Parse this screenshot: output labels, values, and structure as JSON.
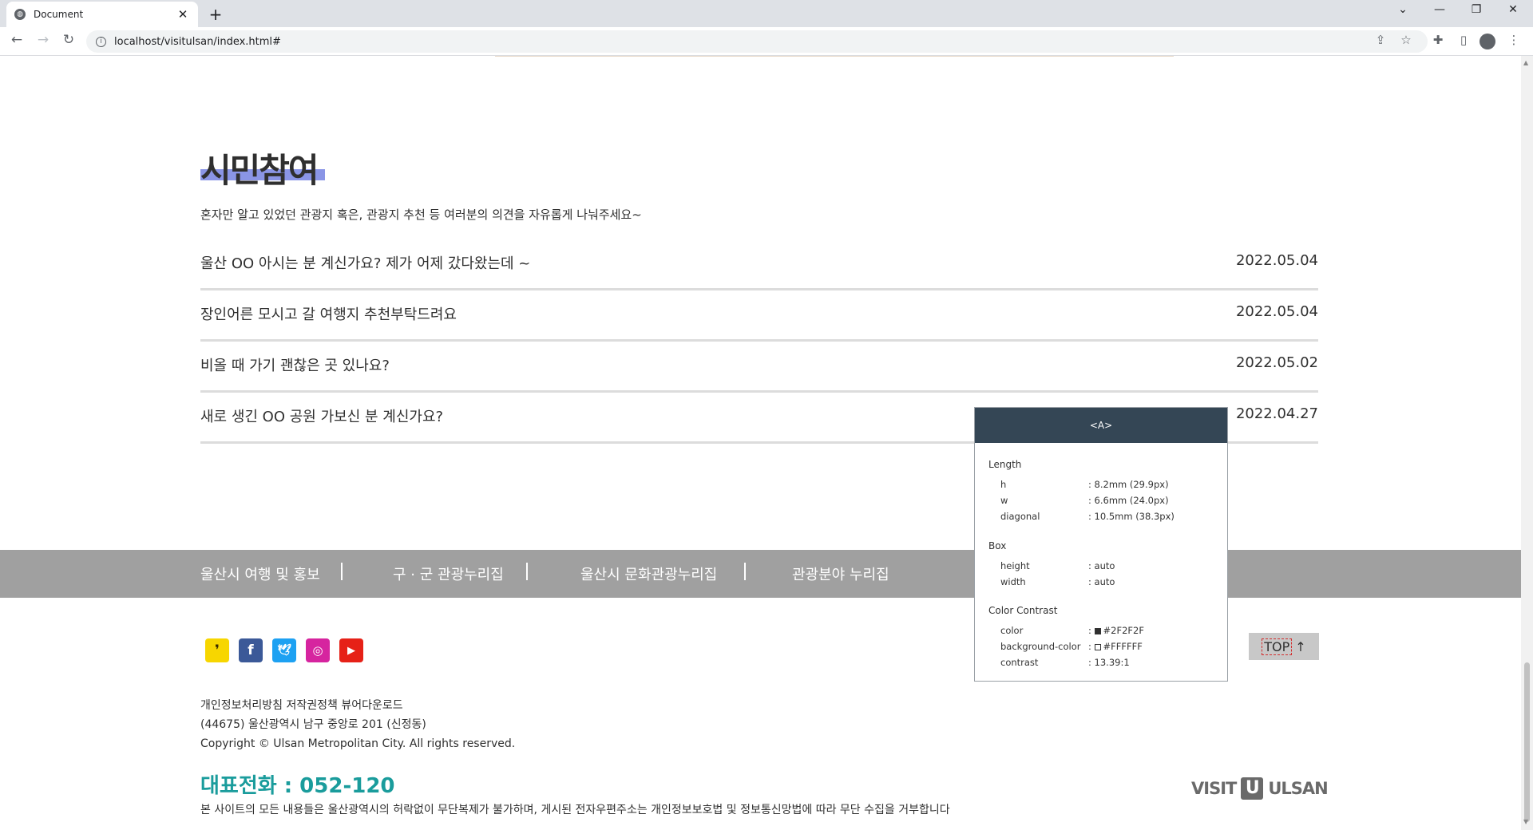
{
  "browser": {
    "tab_title": "Document",
    "tab_close": "✕",
    "new_tab": "+",
    "url": "localhost/visitulsan/index.html#",
    "window_controls": [
      "⌄",
      "—",
      "❐",
      "✕"
    ]
  },
  "section": {
    "title": "시민참여",
    "description": "혼자만 알고 있었던 관광지 혹은, 관광지 추천 등 여러분의 의견을 자유롭게 나눠주세요~",
    "posts": [
      {
        "title": "울산 OO 아시는 분 계신가요? 제가 어제 갔다왔는데 ~",
        "date": "2022.05.04"
      },
      {
        "title": "장인어른 모시고 갈 여행지 추천부탁드려요",
        "date": "2022.05.04"
      },
      {
        "title": "비올 때 가기 괜찮은 곳 있나요?",
        "date": "2022.05.02"
      },
      {
        "title": "새로 생긴 OO 공원 가보신 분 계신가요?",
        "date": "2022.04.27"
      }
    ]
  },
  "footer": {
    "links": [
      "울산시 여행 및 홍보",
      "구 · 군 관광누리집",
      "울산시 문화관광누리집",
      "관광분야 누리집"
    ],
    "top_button": {
      "label": "TOP",
      "arrow": "↑"
    },
    "info_lines": [
      "개인정보처리방침 저작권정책 뷰어다운로드",
      "(44675) 울산광역시 남구 중앙로 201 (신정동)",
      "Copyright © Ulsan Metropolitan City. All rights reserved."
    ],
    "phone": "대표전화 : 052-120",
    "disclaimer": "본 사이트의 모든 내용들은 울산광역시의 허락없이 무단복제가 불가하며, 게시된 전자우편주소는 개인정보보호법 및 정보통신망법에 따라 무단 수집을 거부합니다",
    "logo": {
      "left": "VISIT",
      "mark": "U",
      "right": "ULSAN"
    }
  },
  "inspector": {
    "tag": "<A>",
    "length_label": "Length",
    "h_key": "h",
    "h_val": ": 8.2mm (29.9px)",
    "w_key": "w",
    "w_val": ": 6.6mm (24.0px)",
    "d_key": "diagonal",
    "d_val": ": 10.5mm (38.3px)",
    "box_label": "Box",
    "height_key": "height",
    "height_val": ": auto",
    "width_key": "width",
    "width_val": ": auto",
    "contrast_label": "Color Contrast",
    "color_key": "color",
    "color_val": "#2F2F2F",
    "bg_key": "background-color",
    "bg_val": "#FFFFFF",
    "contrast_key": "contrast",
    "contrast_val": ": 13.39:1"
  },
  "colors": {
    "accent_teal": "#1a9c9c",
    "title_highlight": "#8a95e6",
    "footer_bar": "#a0a0a0",
    "kakao": "#f7d600",
    "facebook": "#3b5998",
    "twitter": "#1da1f2",
    "instagram": "#d6249f",
    "youtube": "#e62117"
  },
  "sns_icons": [
    "kakao-icon",
    "facebook-icon",
    "twitter-icon",
    "instagram-icon",
    "youtube-icon"
  ]
}
